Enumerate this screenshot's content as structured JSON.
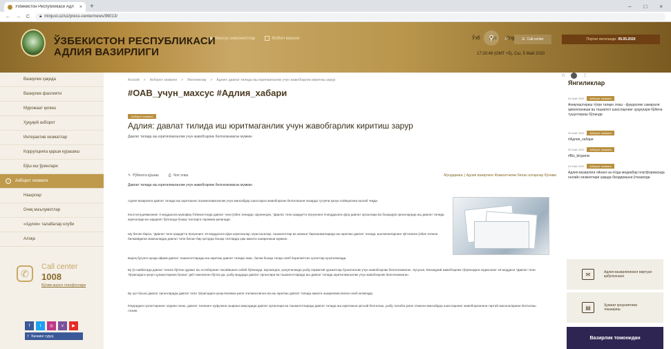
{
  "browser": {
    "tab_title": "Ўзбекистон Республикаси Адл",
    "tab_close": "×",
    "new_tab": "+",
    "url": "minjust.uz/uz/press-center/news/99013/",
    "win_min": "–",
    "win_max": "□",
    "win_close": "×"
  },
  "header": {
    "org_line1": "ЎЗБЕКИСТОН РЕСПУБЛИКАСИ",
    "org_line2": "АДЛИЯ ВАЗИРЛИГИ",
    "link_special": "Махсус имкониятлар",
    "link_mobile": "Мобил версия",
    "langs": [
      "Ўзб",
      "Рус",
      "Eng"
    ],
    "callcenter_btn": "Call-center",
    "date": "17:20:48 (GMT +5), Сш, 5 Май 2020",
    "info_label": "Портал янгиланди:",
    "info_date": "05.05.2020"
  },
  "sidebar": {
    "items": [
      "Вазирлик ҳақида",
      "Вазирлик фаолияти",
      "Мурожаат қилиш",
      "Ҳуқуқий ахборот",
      "Интерактив хизматлар",
      "Коррупцияга қарши курашиш",
      "Бўш иш ўринлари",
      "Ахборот хизмати",
      "Нашрлар",
      "Очиқ маълумотлар",
      "«Адлия» талабалар клуби",
      "Алоқа"
    ],
    "active_index": 7,
    "call_label": "Call center",
    "call_number": "1008",
    "call_sub": "Бўлим ишонч телефонлари",
    "socials": [
      "f",
      "t",
      "◎",
      "v",
      "▶"
    ],
    "social_colors": [
      "#3b5998",
      "#1da1f2",
      "#c13584",
      "#7b519d",
      "#e52d27"
    ],
    "fb_group": "Бизнинг гуруҳ"
  },
  "main": {
    "crumbs": [
      "Асосий",
      ">",
      "Ахборот хизмати",
      ">",
      "Янгиликлар",
      ">",
      "Адлия: давлат тилида иш юритмаганлик учун жавобгарлик киритиш зарур"
    ],
    "tags_title": "#ОАВ_учун_махсус #Адлия_хабари",
    "badge": "Ахборот хизмати",
    "title": "Адлия: давлат тилида иш юритмаганлик учун жавобгарлик киритиш зарур",
    "subtitle": "Давлат тилида иш юритилмаганлик учун жавобгарлик белгиланмаган мумкин",
    "action_print": "Чоп этиш",
    "action_reader": "Рўйхатга қўшиш",
    "related": "Мундарижа: | Адлия вазирлиги Жамоатчилик билан алоқалар бўлими",
    "lead": "Давлат тилида иш юритилмаганлик учун жавобгарлик белгиланмаган мумкин",
    "paragraphs": [
      "Адлия вазирлиги давлат тилида иш юритишни таъминламаганлик учун мансабдор шахсларга жавобгарлик белгилашни назарда тутувчи қонун лойиҳасини ишлаб чиқди.",
      "Конституциямизнинг 4-моддасига мувофиқ Ўзбекистонда давлат тили ўзбек тилидир. Шунингдек, \"Давлат тили ҳақида\"ги Қонуннинг 9-моддасига кўра давлат органлари ва бошқарув органларида иш давлат тилида юритилади ва зарурият бўлганда бошқа тилларга таржима қилинади.",
      "Шу билан бирга, \"Давлат тили ҳақида\"ги Қонуннинг 10-моддасига кўра корхоналар, муассасалар, ташкилотлар ва жамоат бирлашмаларида иш юритиш давлат тилида, ишловчиларнинг кўпчилиги ўзбек тилини билмайдиган жамоаларда давлат тили билан бир қаторда бошқа тилларда ҳам амалга оширилиши мумкин.",
      "Бироқ бугунги кунда айрим давлат ташкилотларида иш юритиш давлат тилида эмас, балки бошқа тилда олиб борилаётган ҳолатлар кузатилмоқда.",
      "Бу ўз навбатида давлат тилига бўлган ҳурмат ва эътиборнинг пасайишига сабаб бўлмоқда. Шунингдек, қонунчиликда ушбу норматив ҳужжатлар бузилганлик учун жавобгарлик белгиланмаган. Хусусан, Маъмурий жавобгарлик тўғрисидаги кодекснинг 42-моддаси \"Давлат тили тўғрисидаги қонун ҳужжатларини бузиш\" деб номланган бўлса-да, ушбу моддада давлат органлари ва ташкилотларида иш давлат тилида юритилмаганлик учун жавобгарлик белгиланмаган.",
      "Бу ҳол баъзи давлат органларида давлат тили тўғрисидаги қонунчиликка риоя этилмаслигига ва иш юритиш давлат тилида амалга оширилмаслигига олиб келмоқда.",
      "Юқоридаги ҳолатларнинг олдини олиш, давлат тилининг нуфузини ошириш мақсадида давлат органлари ва ташкилотларида давлат тилида иш юритишни қатъий белгилаш, ушбу талабга риоя этмаган мансабдор шахсларнинг жавобгарлигини тартиб масалаларини белгилаш лозим."
    ]
  },
  "right": {
    "news_heading": "Янгиликлар",
    "news": [
      {
        "date": "05 Май 2020",
        "badge": "Ахборот хизмати",
        "text": "Аниқлаштириш тўғри талқин этиш - фуқаролик самарали ҳимояланиши ва ташкилот шахсларнинг ҳуқуқлари бўйича тушунтириш бўлинди"
      },
      {
        "date": "05 Май 2020",
        "badge": "Ахборот хизмати",
        "text": "#Адлия_хабари"
      },
      {
        "date": "05 Май 2020",
        "badge": "Ахборот хизмати",
        "text": "#Biz_birgamiz"
      },
      {
        "date": "04 Май 2020",
        "badge": "Ахборот хизмати",
        "text": "Адлия вазирлиги ойнанг-ан ёлда медиабар платформасида онлайн хизматлари ҳақида билдиришни ўтказилди."
      }
    ],
    "box1": "Адлия вазирлигининг виртуал қабулхонаси",
    "box2": "Ҳужжат қонуниятини текшириш",
    "ministry": "Вазирлик томонидан"
  },
  "colors": {
    "gold": "#b98f3f",
    "brown": "#6e3f12",
    "ministry_bg": "#2e2552"
  }
}
